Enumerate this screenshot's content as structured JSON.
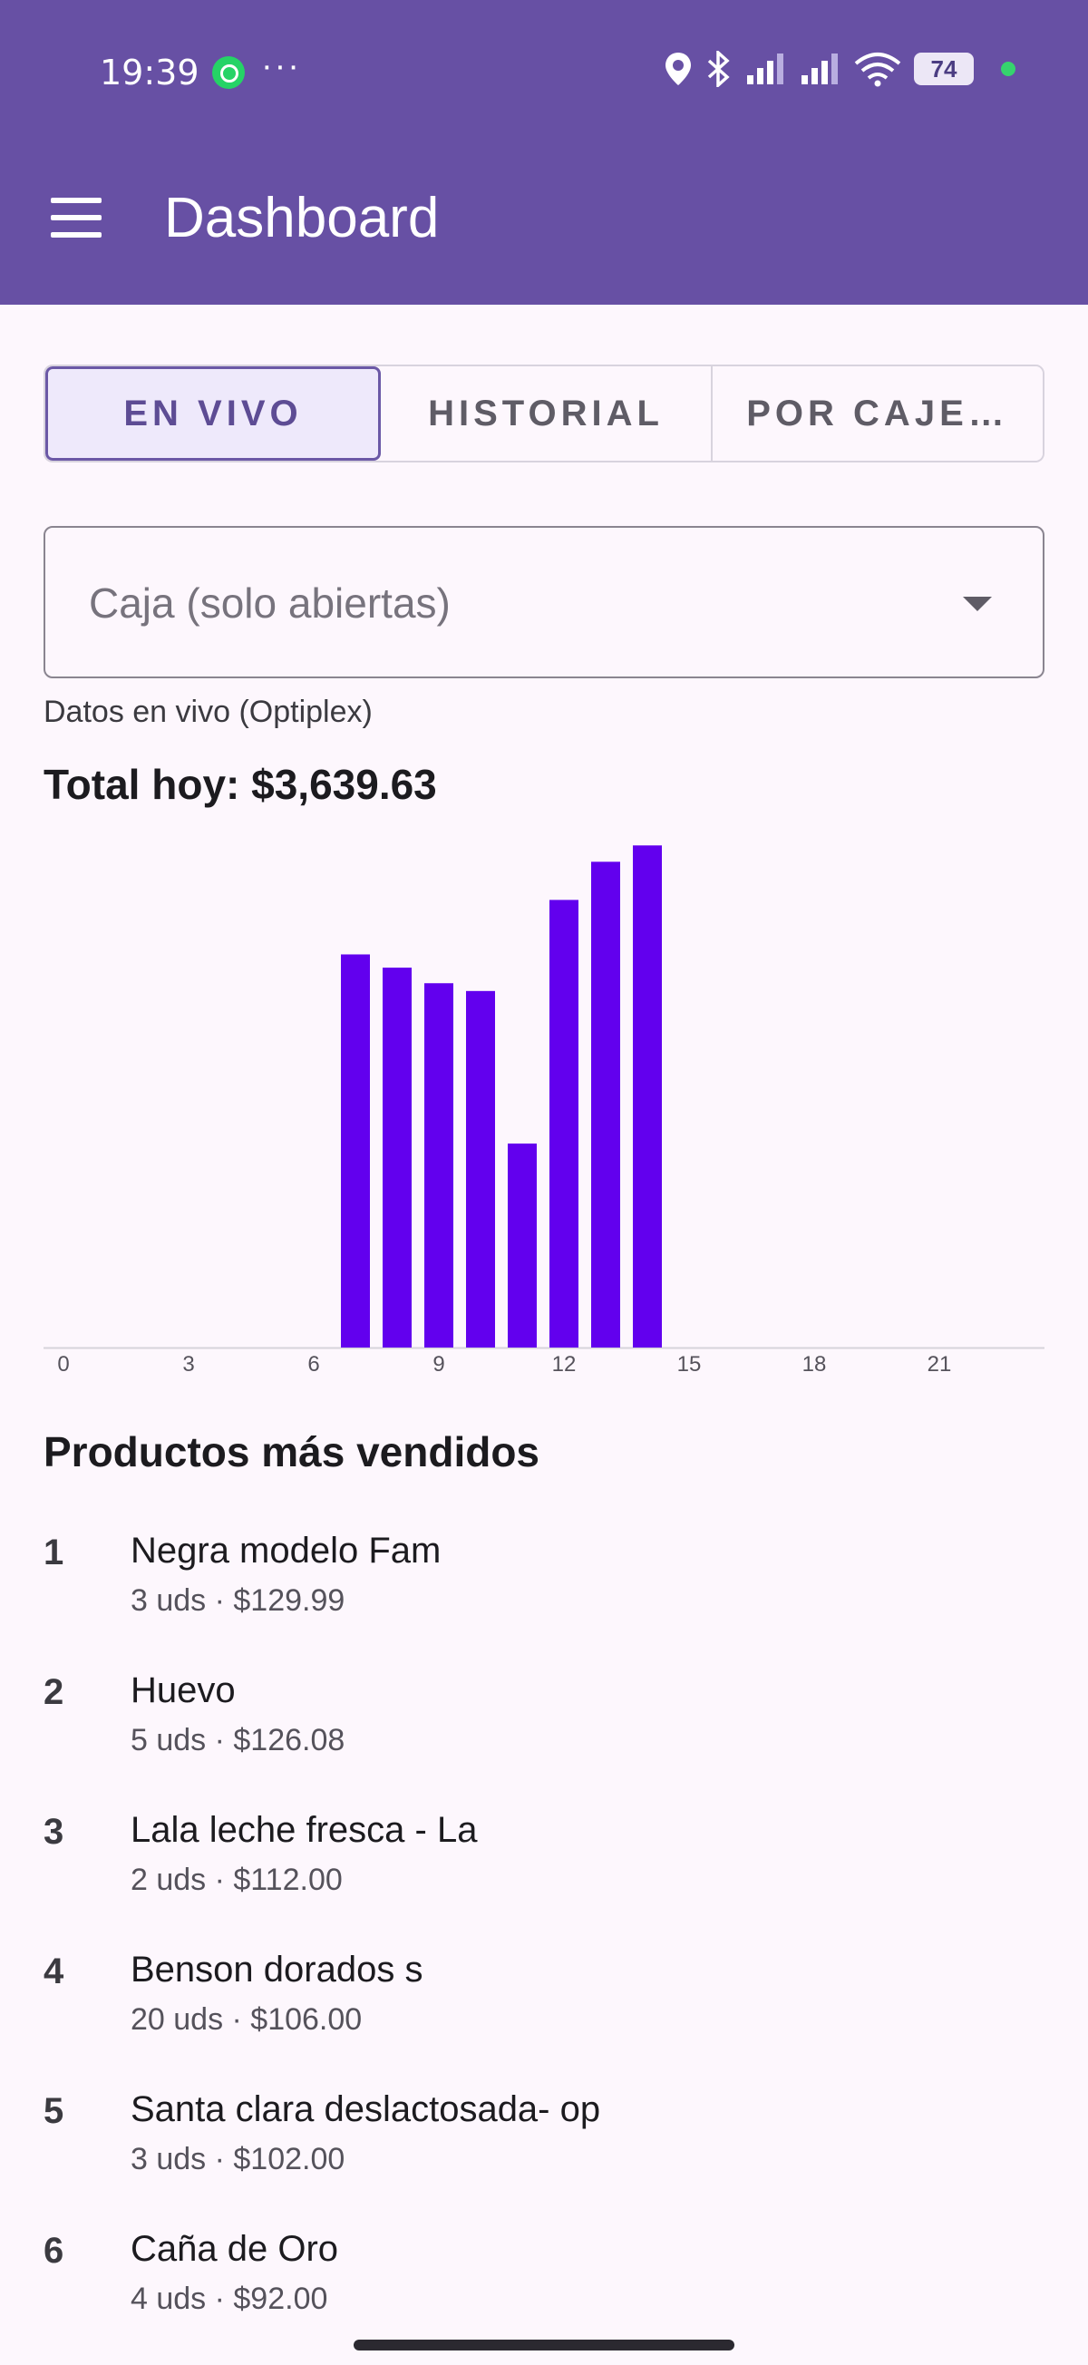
{
  "status_bar": {
    "time": "19:39",
    "battery": "74",
    "icons": [
      "whatsapp-icon",
      "more-icon",
      "location-icon",
      "bluetooth-icon",
      "signal-icon",
      "signal-icon",
      "wifi-icon",
      "battery-icon"
    ]
  },
  "app_bar": {
    "title": "Dashboard",
    "menu_icon": "menu-icon"
  },
  "tabs": [
    {
      "label": "EN VIVO",
      "active": true
    },
    {
      "label": "HISTORIAL",
      "active": false
    },
    {
      "label": "POR CAJE…",
      "active": false
    }
  ],
  "caja_select": {
    "placeholder": "Caja (solo abiertas)",
    "icon": "dropdown-arrow-icon"
  },
  "live_source": "Datos en vivo (Optiplex)",
  "total_today": "Total hoy: $3,639.63",
  "chart_data": {
    "type": "bar",
    "x": [
      7,
      8,
      9,
      10,
      11,
      12,
      13,
      14
    ],
    "values": [
      505,
      488,
      468,
      458,
      262,
      575,
      624,
      645
    ],
    "xticks": [
      "0",
      "3",
      "6",
      "9",
      "12",
      "15",
      "18",
      "21"
    ],
    "xlim": [
      0,
      24
    ],
    "ylim": [
      0,
      650
    ],
    "bar_color": "#6200ee",
    "grid": false,
    "legend": "none"
  },
  "top_products": {
    "title": "Productos más vendidos",
    "items": [
      {
        "rank": "1",
        "name": "Negra modelo Fam",
        "detail": "3 uds · $129.99"
      },
      {
        "rank": "2",
        "name": "Huevo",
        "detail": "5 uds · $126.08"
      },
      {
        "rank": "3",
        "name": "Lala leche fresca - La",
        "detail": "2 uds · $112.00"
      },
      {
        "rank": "4",
        "name": "Benson dorados s",
        "detail": "20 uds · $106.00"
      },
      {
        "rank": "5",
        "name": "Santa clara deslactosada- op",
        "detail": "3 uds · $102.00"
      },
      {
        "rank": "6",
        "name": "Caña de Oro",
        "detail": "4 uds · $92.00"
      }
    ]
  },
  "colors": {
    "primary": "#6750a4",
    "accent_bar": "#6200ee",
    "background": "#fdf7fd"
  }
}
